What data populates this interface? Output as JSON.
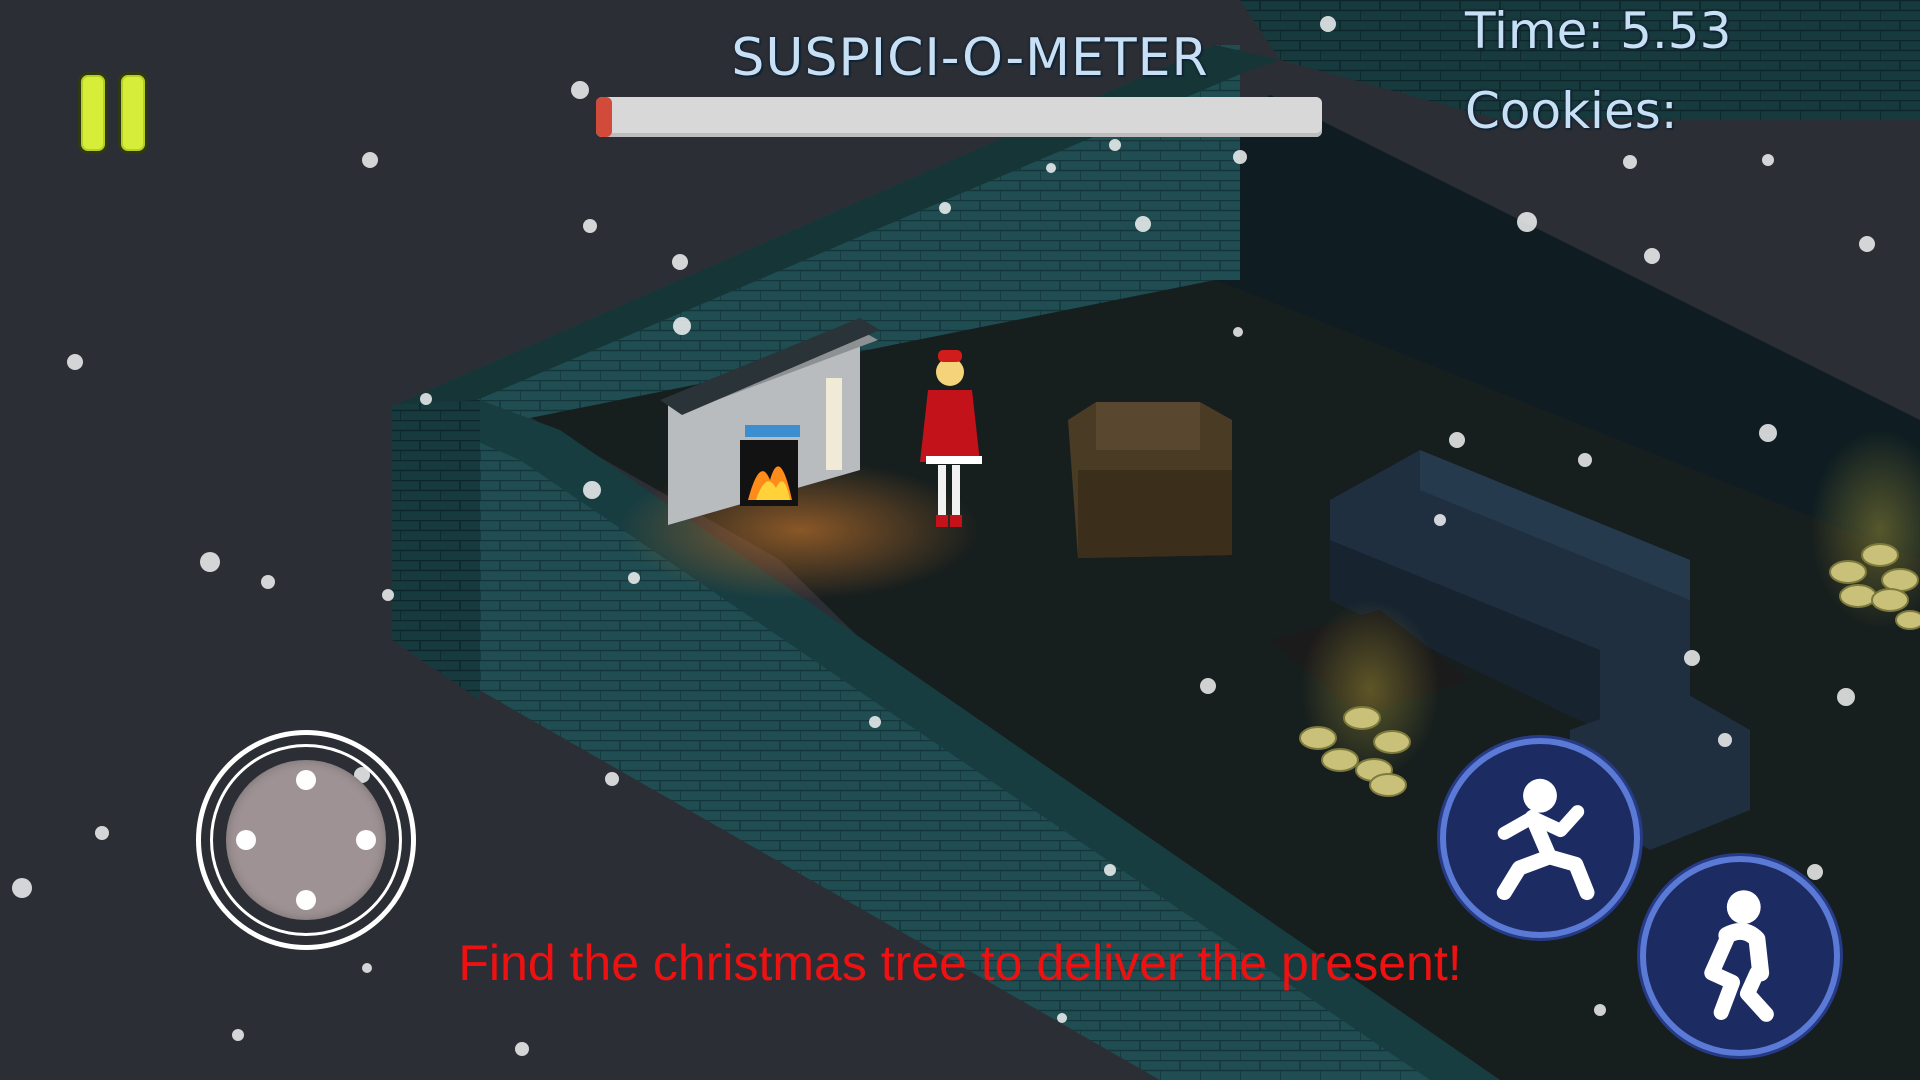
{
  "hud": {
    "meter_title": "SUSPICI-O-METER",
    "suspicion_level": 0.02,
    "time_text": "Time: 5.53",
    "cookies_text": "Cookies:",
    "objective": "Find the christmas tree to deliver the present!"
  },
  "icons": {
    "pause": "pause-icon",
    "joystick": "virtual-joystick",
    "jump": "jumping-person-icon",
    "crouch": "crouching-person-icon"
  },
  "colors": {
    "hud_text": "#c7e0f5",
    "pause": "#d6ee3a",
    "meter_fill": "#d24a3a",
    "meter_track": "#d8d8d8",
    "objective_text": "#ee1111",
    "action_button_bg": "#1d2b63",
    "action_button_border": "#5b7ad6"
  }
}
